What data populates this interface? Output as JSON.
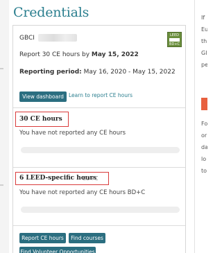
{
  "title": "Credentials",
  "gbci": {
    "label": "GBCI"
  },
  "badge": {
    "line1": "LEED",
    "line2": "BD+C"
  },
  "report": {
    "prefix": "Report 30 CE hours by",
    "date": "May 15, 2022"
  },
  "period": {
    "label": "Reporting period:",
    "value": "May 16, 2020 - May 15, 2022"
  },
  "buttons": {
    "view_dashboard": "View dashboard",
    "report_ce": "Report CE hours",
    "find_courses": "Find courses",
    "find_volunteer": "Find Volunteer Opportunities"
  },
  "learn_link": "Learn to report CE hours",
  "ce_section": {
    "title": "30 CE hours",
    "status": "You have not reported any CE hours",
    "progress": 0
  },
  "leed_section": {
    "title": "6 LEED-specific hours",
    "subtitle": "BD+C",
    "status": "You have not reported any CE hours BD+C",
    "progress": 0
  },
  "right_panel": {
    "lines": [
      "If",
      "Eu",
      "th",
      "Gl",
      "pe",
      "Fo",
      "or",
      "da",
      "lo",
      "to"
    ]
  },
  "colors": {
    "accent": "#2a7e8e",
    "button": "#2b6e80",
    "highlight": "#d93a3a"
  }
}
